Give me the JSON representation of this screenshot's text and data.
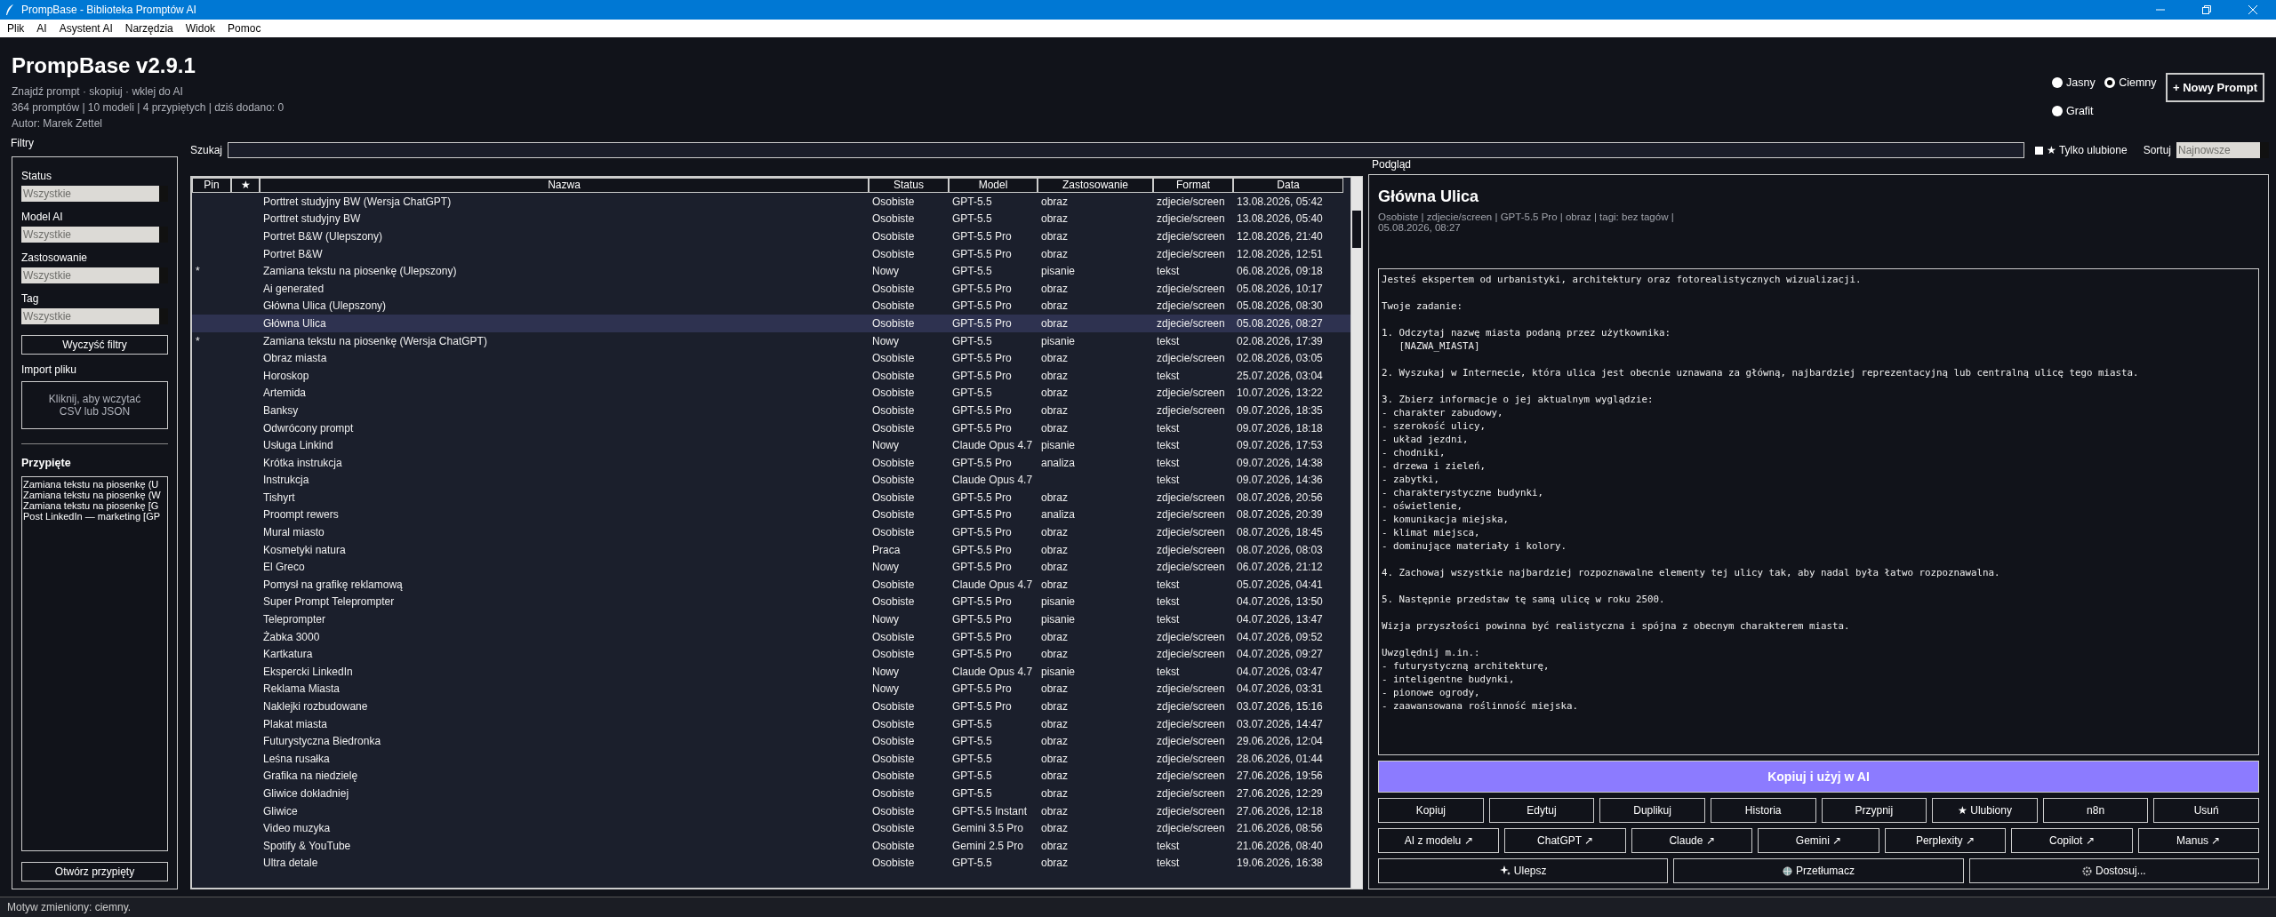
{
  "window": {
    "title": "PrompBase - Biblioteka Promptów AI"
  },
  "menu": [
    "Plik",
    "AI",
    "Asystent AI",
    "Narzędzia",
    "Widok",
    "Pomoc"
  ],
  "header": {
    "title": "PrompBase v2.9.1",
    "subtitle": "Znajdź prompt · skopiuj · wklej do AI",
    "stats": "364 promptów | 10 modeli | 4 przypiętych | dziś dodano: 0",
    "author": "Autor: Marek Zettel"
  },
  "theme": [
    {
      "label": "Jasny",
      "selected": false
    },
    {
      "label": "Ciemny",
      "selected": true
    },
    {
      "label": "Grafit",
      "selected": false
    }
  ],
  "new_button": "+ Nowy Prompt",
  "search": {
    "label": "Szukaj",
    "favorites_only": {
      "label": "★ Tylko ulubione",
      "checked": false
    },
    "sort_label": "Sortuj",
    "sort_value": "Najnowsze"
  },
  "filters": {
    "title": "Filtry",
    "fields": [
      {
        "label": "Status",
        "value": "Wszystkie"
      },
      {
        "label": "Model AI",
        "value": "Wszystkie"
      },
      {
        "label": "Zastosowanie",
        "value": "Wszystkie"
      },
      {
        "label": "Tag",
        "value": "Wszystkie"
      }
    ],
    "clear_button": "Wyczyść filtry",
    "import_label": "Import pliku",
    "import_hint": "Kliknij, aby wczytać\nCSV lub JSON",
    "pinned_title": "Przypięte",
    "pinned": [
      "Zamiana tekstu na piosenkę (U",
      "Zamiana tekstu na piosenkę (W",
      "Zamiana tekstu na piosenkę [G",
      "Post LinkedIn — marketing [GP"
    ],
    "open_pinned_button": "Otwórz przypięty"
  },
  "table": {
    "columns": [
      "Pin",
      "★",
      "Nazwa",
      "Status",
      "Model",
      "Zastosowanie",
      "Format",
      "Data"
    ],
    "rows": [
      {
        "name": "Porttret studyjny BW (Wersja ChatGPT)",
        "status": "Osobiste",
        "model": "GPT-5.5",
        "use": "obraz",
        "format": "zdjecie/screen",
        "date": "13.08.2026, 05:42",
        "selected": false
      },
      {
        "name": "Porttret studyjny BW",
        "status": "Osobiste",
        "model": "GPT-5.5",
        "use": "obraz",
        "format": "zdjecie/screen",
        "date": "13.08.2026, 05:40",
        "selected": false
      },
      {
        "name": "Portret B&W (Ulepszony)",
        "status": "Osobiste",
        "model": "GPT-5.5 Pro",
        "use": "obraz",
        "format": "zdjecie/screen",
        "date": "12.08.2026, 21:40",
        "selected": false
      },
      {
        "name": "Portret B&W",
        "status": "Osobiste",
        "model": "GPT-5.5 Pro",
        "use": "obraz",
        "format": "zdjecie/screen",
        "date": "12.08.2026, 12:51",
        "selected": false
      },
      {
        "pin": "*",
        "name": "Zamiana tekstu na piosenkę (Ulepszony)",
        "status": "Nowy",
        "model": "GPT-5.5",
        "use": "pisanie",
        "format": "tekst",
        "date": "06.08.2026, 09:18",
        "selected": false
      },
      {
        "name": "Ai generated",
        "status": "Osobiste",
        "model": "GPT-5.5 Pro",
        "use": "obraz",
        "format": "zdjecie/screen",
        "date": "05.08.2026, 10:17",
        "selected": false
      },
      {
        "name": "Główna Ulica (Ulepszony)",
        "status": "Osobiste",
        "model": "GPT-5.5 Pro",
        "use": "obraz",
        "format": "zdjecie/screen",
        "date": "05.08.2026, 08:30",
        "selected": false
      },
      {
        "name": "Główna Ulica",
        "status": "Osobiste",
        "model": "GPT-5.5 Pro",
        "use": "obraz",
        "format": "zdjecie/screen",
        "date": "05.08.2026, 08:27",
        "selected": true
      },
      {
        "pin": "*",
        "name": "Zamiana tekstu na piosenkę (Wersja ChatGPT)",
        "status": "Nowy",
        "model": "GPT-5.5",
        "use": "pisanie",
        "format": "tekst",
        "date": "02.08.2026, 17:39",
        "selected": false
      },
      {
        "name": "Obraz miasta",
        "status": "Osobiste",
        "model": "GPT-5.5 Pro",
        "use": "obraz",
        "format": "zdjecie/screen",
        "date": "02.08.2026, 03:05",
        "selected": false
      },
      {
        "name": "Horoskop",
        "status": "Osobiste",
        "model": "GPT-5.5 Pro",
        "use": "obraz",
        "format": "tekst",
        "date": "25.07.2026, 03:04",
        "selected": false
      },
      {
        "name": "Artemida",
        "status": "Osobiste",
        "model": "GPT-5.5",
        "use": "obraz",
        "format": "zdjecie/screen",
        "date": "10.07.2026, 13:22",
        "selected": false
      },
      {
        "name": "Banksy",
        "status": "Osobiste",
        "model": "GPT-5.5 Pro",
        "use": "obraz",
        "format": "zdjecie/screen",
        "date": "09.07.2026, 18:35",
        "selected": false
      },
      {
        "name": "Odwrócony prompt",
        "status": "Osobiste",
        "model": "GPT-5.5 Pro",
        "use": "obraz",
        "format": "tekst",
        "date": "09.07.2026, 18:18",
        "selected": false
      },
      {
        "name": "Usługa Linkind",
        "status": "Nowy",
        "model": "Claude Opus 4.7",
        "use": "pisanie",
        "format": "tekst",
        "date": "09.07.2026, 17:53",
        "selected": false
      },
      {
        "name": "Krótka instrukcja",
        "status": "Osobiste",
        "model": "GPT-5.5 Pro",
        "use": "analiza",
        "format": "tekst",
        "date": "09.07.2026, 14:38",
        "selected": false
      },
      {
        "name": "Instrukcja",
        "status": "Osobiste",
        "model": "Claude Opus 4.7",
        "format": "tekst",
        "date": "09.07.2026, 14:36",
        "selected": false
      },
      {
        "name": "Tishyrt",
        "status": "Osobiste",
        "model": "GPT-5.5 Pro",
        "use": "obraz",
        "format": "zdjecie/screen",
        "date": "08.07.2026, 20:56",
        "selected": false
      },
      {
        "name": "Proompt rewers",
        "status": "Osobiste",
        "model": "GPT-5.5 Pro",
        "use": "analiza",
        "format": "zdjecie/screen",
        "date": "08.07.2026, 20:39",
        "selected": false
      },
      {
        "name": "Mural miasto",
        "status": "Osobiste",
        "model": "GPT-5.5 Pro",
        "use": "obraz",
        "format": "zdjecie/screen",
        "date": "08.07.2026, 18:45",
        "selected": false
      },
      {
        "name": "Kosmetyki natura",
        "status": "Praca",
        "model": "GPT-5.5 Pro",
        "use": "obraz",
        "format": "zdjecie/screen",
        "date": "08.07.2026, 08:03",
        "selected": false
      },
      {
        "name": "El Greco",
        "status": "Nowy",
        "model": "GPT-5.5 Pro",
        "use": "obraz",
        "format": "zdjecie/screen",
        "date": "06.07.2026, 21:12",
        "selected": false
      },
      {
        "name": "Pomysł na grafikę reklamową",
        "status": "Osobiste",
        "model": "Claude Opus 4.7",
        "use": "obraz",
        "format": "tekst",
        "date": "05.07.2026, 04:41",
        "selected": false
      },
      {
        "name": "Super Prompt Teleprompter",
        "status": "Osobiste",
        "model": "GPT-5.5 Pro",
        "use": "pisanie",
        "format": "tekst",
        "date": "04.07.2026, 13:50",
        "selected": false
      },
      {
        "name": "Teleprompter",
        "status": "Nowy",
        "model": "GPT-5.5 Pro",
        "use": "pisanie",
        "format": "tekst",
        "date": "04.07.2026, 13:47",
        "selected": false
      },
      {
        "name": "Żabka 3000",
        "status": "Osobiste",
        "model": "GPT-5.5 Pro",
        "use": "obraz",
        "format": "zdjecie/screen",
        "date": "04.07.2026, 09:52",
        "selected": false
      },
      {
        "name": "Kartkatura",
        "status": "Osobiste",
        "model": "GPT-5.5 Pro",
        "use": "obraz",
        "format": "zdjecie/screen",
        "date": "04.07.2026, 09:27",
        "selected": false
      },
      {
        "name": "Ekspercki LinkedIn",
        "status": "Nowy",
        "model": "Claude Opus 4.7",
        "use": "pisanie",
        "format": "tekst",
        "date": "04.07.2026, 03:47",
        "selected": false
      },
      {
        "name": "Reklama Miasta",
        "status": "Nowy",
        "model": "GPT-5.5 Pro",
        "use": "obraz",
        "format": "zdjecie/screen",
        "date": "04.07.2026, 03:31",
        "selected": false
      },
      {
        "name": "Naklejki rozbudowane",
        "status": "Osobiste",
        "model": "GPT-5.5 Pro",
        "use": "obraz",
        "format": "zdjecie/screen",
        "date": "03.07.2026, 15:16",
        "selected": false
      },
      {
        "name": "Plakat miasta",
        "status": "Osobiste",
        "model": "GPT-5.5",
        "use": "obraz",
        "format": "zdjecie/screen",
        "date": "03.07.2026, 14:47",
        "selected": false
      },
      {
        "name": "Futurystyczna Biedronka",
        "status": "Osobiste",
        "model": "GPT-5.5",
        "use": "obraz",
        "format": "zdjecie/screen",
        "date": "29.06.2026, 12:04",
        "selected": false
      },
      {
        "name": "Leśna rusałka",
        "status": "Osobiste",
        "model": "GPT-5.5",
        "use": "obraz",
        "format": "zdjecie/screen",
        "date": "28.06.2026, 01:44",
        "selected": false
      },
      {
        "name": "Grafika na niedzielę",
        "status": "Osobiste",
        "model": "GPT-5.5",
        "use": "obraz",
        "format": "zdjecie/screen",
        "date": "27.06.2026, 19:56",
        "selected": false
      },
      {
        "name": "Gliwice dokładniej",
        "status": "Osobiste",
        "model": "GPT-5.5",
        "use": "obraz",
        "format": "zdjecie/screen",
        "date": "27.06.2026, 12:29",
        "selected": false
      },
      {
        "name": "Gliwice",
        "status": "Osobiste",
        "model": "GPT-5.5 Instant",
        "use": "obraz",
        "format": "zdjecie/screen",
        "date": "27.06.2026, 12:18",
        "selected": false
      },
      {
        "name": "Video muzyka",
        "status": "Osobiste",
        "model": "Gemini 3.5 Pro",
        "use": "obraz",
        "format": "zdjecie/screen",
        "date": "21.06.2026, 08:56",
        "selected": false
      },
      {
        "name": "Spotify & YouTube",
        "status": "Osobiste",
        "model": "Gemini 2.5 Pro",
        "use": "obraz",
        "format": "tekst",
        "date": "21.06.2026, 08:40",
        "selected": false
      },
      {
        "name": "Ultra detale",
        "status": "Osobiste",
        "model": "GPT-5.5",
        "use": "obraz",
        "format": "tekst",
        "date": "19.06.2026, 16:38",
        "selected": false
      }
    ]
  },
  "preview": {
    "label": "Podgląd",
    "title": "Główna Ulica",
    "meta": "Osobiste | zdjecie/screen | GPT-5.5 Pro | obraz | tagi: bez tagów | 05.08.2026, 08:27",
    "body": "Jesteś ekspertem od urbanistyki, architektury oraz fotorealistycznych wizualizacji.\n\nTwoje zadanie:\n\n1. Odczytaj nazwę miasta podaną przez użytkownika:\n   [NAZWA_MIASTA]\n\n2. Wyszukaj w Internecie, która ulica jest obecnie uznawana za główną, najbardziej reprezentacyjną lub centralną ulicę tego miasta.\n\n3. Zbierz informacje o jej aktualnym wyglądzie:\n- charakter zabudowy,\n- szerokość ulicy,\n- układ jezdni,\n- chodniki,\n- drzewa i zieleń,\n- zabytki,\n- charakterystyczne budynki,\n- oświetlenie,\n- komunikacja miejska,\n- klimat miejsca,\n- dominujące materiały i kolory.\n\n4. Zachowaj wszystkie najbardziej rozpoznawalne elementy tej ulicy tak, aby nadal była łatwo rozpoznawalna.\n\n5. Następnie przedstaw tę samą ulicę w roku 2500.\n\nWizja przyszłości powinna być realistyczna i spójna z obecnym charakterem miasta.\n\nUwzględnij m.in.:\n- futurystyczną architekturę,\n- inteligentne budynki,\n- pionowe ogrody,\n- zaawansowana roślinność miejska.",
    "main_button": "Kopiuj i użyj w AI",
    "actions": [
      "Kopiuj",
      "Edytuj",
      "Duplikuj",
      "Historia",
      "Przypnij",
      "★ Ulubiony",
      "n8n",
      "Usuń"
    ],
    "ai_links": [
      "AI z modelu ↗",
      "ChatGPT ↗",
      "Claude ↗",
      "Gemini ↗",
      "Perplexity ↗",
      "Copilot ↗",
      "Manus ↗"
    ],
    "tools": [
      "Ulepsz",
      "Przetłumacz",
      "Dostosuj..."
    ]
  },
  "status_bar": "Motyw zmieniony: ciemny."
}
